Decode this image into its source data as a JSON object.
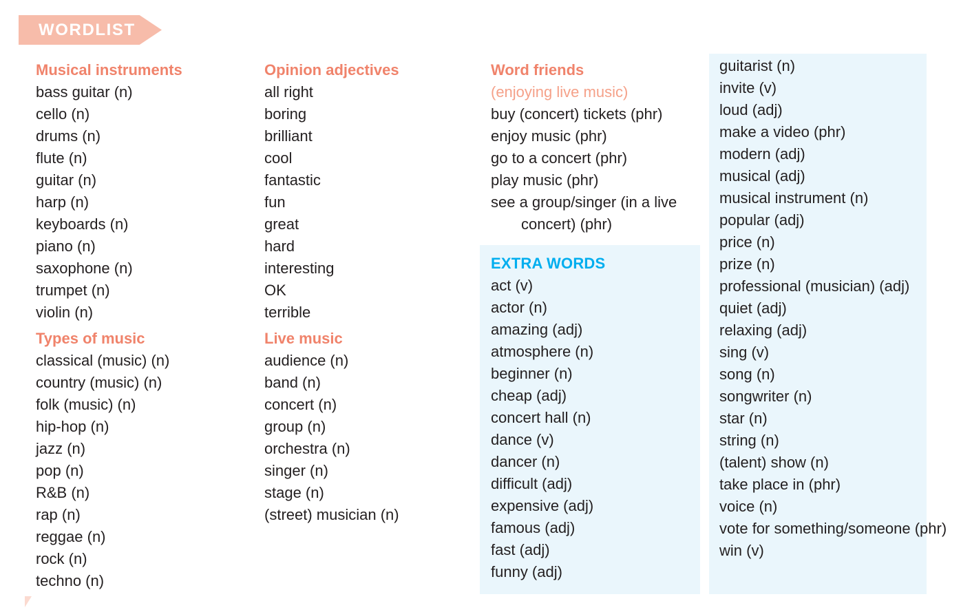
{
  "banner": {
    "label": "WORDLIST",
    "background_color": "#F7BCAA",
    "text_color": "#FFFFFF"
  },
  "colors": {
    "heading_salmon": "#F0836B",
    "subheading_salmon": "#F5A189",
    "extra_words_cyan": "#00AEEF",
    "panel_blue": "#EAF6FC",
    "body_text": "#231F20"
  },
  "columns": [
    {
      "id": "column-1",
      "sections": [
        {
          "id": "musical-instruments",
          "heading": "Musical instruments",
          "items": [
            "bass guitar (n)",
            "cello (n)",
            "drums (n)",
            "flute (n)",
            "guitar (n)",
            "harp (n)",
            "keyboards (n)",
            "piano (n)",
            "saxophone (n)",
            "trumpet (n)",
            "violin (n)"
          ]
        },
        {
          "id": "types-of-music",
          "heading": "Types of music",
          "items": [
            "classical (music) (n)",
            "country (music) (n)",
            "folk (music) (n)",
            "hip-hop (n)",
            "jazz (n)",
            "pop (n)",
            "R&B (n)",
            "rap (n)",
            "reggae (n)",
            "rock (n)",
            "techno (n)"
          ]
        }
      ]
    },
    {
      "id": "column-2",
      "sections": [
        {
          "id": "opinion-adjectives",
          "heading": "Opinion adjectives",
          "items": [
            "all right",
            "boring",
            "brilliant",
            "cool",
            "fantastic",
            "fun",
            "great",
            "hard",
            "interesting",
            "OK",
            "terrible"
          ]
        },
        {
          "id": "live-music",
          "heading": "Live music",
          "items": [
            "audience (n)",
            "band (n)",
            "concert (n)",
            "group (n)",
            "orchestra (n)",
            "singer (n)",
            "stage (n)",
            "(street) musician (n)"
          ]
        }
      ]
    },
    {
      "id": "column-3",
      "sections": [
        {
          "id": "word-friends",
          "heading": "Word friends",
          "subheading": "(enjoying live music)",
          "items": [
            "buy (concert) tickets (phr)",
            "enjoy music (phr)",
            "go to a concert (phr)",
            "play music (phr)",
            "see a group/singer (in a live concert) (phr)"
          ]
        },
        {
          "id": "extra-words-left",
          "heading": "EXTRA WORDS",
          "items": [
            "act (v)",
            "actor (n)",
            "amazing (adj)",
            "atmosphere (n)",
            "beginner (n)",
            "cheap (adj)",
            "concert hall (n)",
            "dance (v)",
            "dancer (n)",
            "difficult (adj)",
            "expensive (adj)",
            "famous (adj)",
            "fast (adj)",
            "funny (adj)"
          ]
        }
      ]
    },
    {
      "id": "column-4",
      "sections": [
        {
          "id": "extra-words-right",
          "heading": "",
          "items": [
            "guitarist (n)",
            "invite (v)",
            "loud (adj)",
            "make a video (phr)",
            "modern (adj)",
            "musical (adj)",
            "musical instrument (n)",
            "popular (adj)",
            "price (n)",
            "prize (n)",
            "professional (musician) (adj)",
            "quiet (adj)",
            "relaxing (adj)",
            "sing (v)",
            "song (n)",
            "songwriter (n)",
            "star (n)",
            "string (n)",
            "(talent) show (n)",
            "take place in (phr)",
            "voice (n)",
            "vote for something/someone (phr)",
            "win (v)"
          ]
        }
      ]
    }
  ]
}
